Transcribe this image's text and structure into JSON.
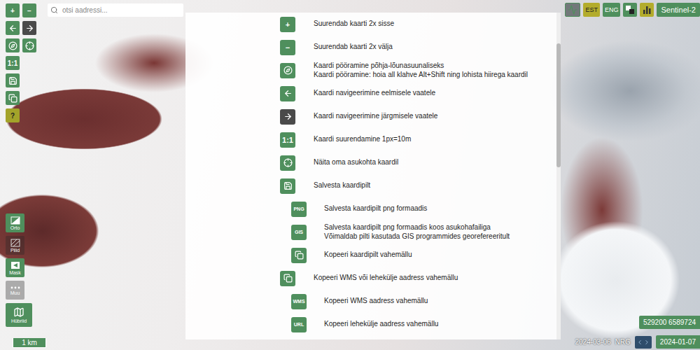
{
  "search": {
    "placeholder": "otsi aadressi..."
  },
  "toolbar": {
    "rows": [
      [
        {
          "kind": "text",
          "label": "+",
          "color": "#4f8f5d",
          "disabled": false
        },
        {
          "kind": "text",
          "label": "−",
          "color": "#4f8f5d",
          "disabled": false
        }
      ],
      [
        {
          "kind": "arrow-left",
          "color": "#4f8f5d",
          "disabled": false
        },
        {
          "kind": "arrow-right",
          "color": "#4a4a4a",
          "disabled": true
        }
      ],
      [
        {
          "kind": "compass",
          "color": "#4f8f5d",
          "disabled": false
        },
        {
          "kind": "target",
          "color": "#4f8f5d",
          "disabled": false
        }
      ],
      [
        {
          "kind": "text",
          "label": "1:1",
          "color": "#4f8f5d",
          "disabled": false
        }
      ],
      [
        {
          "kind": "save",
          "color": "#4f8f5d",
          "disabled": false
        }
      ],
      [
        {
          "kind": "copy",
          "color": "#4f8f5d",
          "disabled": false
        }
      ],
      [
        {
          "kind": "text",
          "label": "?",
          "color": "#a3a32a",
          "disabled": false
        }
      ]
    ]
  },
  "top_right": [
    {
      "kind": "chart"
    },
    {
      "kind": "lang",
      "label": "EST",
      "selected": true
    },
    {
      "kind": "lang",
      "label": "ENG",
      "selected": false
    },
    {
      "kind": "layers"
    },
    {
      "kind": "stats"
    },
    {
      "kind": "source",
      "label": "Sentinel-2"
    }
  ],
  "layers": [
    {
      "kind": "orto",
      "label": "Orto",
      "active": true
    },
    {
      "kind": "pilid",
      "label": "Pilid",
      "active": false
    },
    {
      "kind": "mask",
      "label": "Mask",
      "active": true
    },
    {
      "kind": "muu",
      "label": "Muu",
      "active": false
    },
    {
      "kind": "hybrid",
      "label": "Hübriid",
      "active": true
    }
  ],
  "scale": "1 km",
  "status": {
    "date_left": "2024-03-06",
    "band": "NRG",
    "date_right": "2024-01-07",
    "coordinates": "529200 6589724"
  },
  "help": {
    "scrollbar": {
      "level": 0.38
    },
    "items": [
      {
        "kind": "text",
        "icon_label": "+",
        "lines": [
          "Suurendab kaarti 2x sisse"
        ],
        "sub": false,
        "disabled": false
      },
      {
        "kind": "text",
        "icon_label": "−",
        "lines": [
          "Suurendab kaarti 2x välja"
        ],
        "sub": false,
        "disabled": false
      },
      {
        "kind": "compass",
        "lines": [
          "Kaardi pööramine põhja-lõunasuunaliseks",
          "Kaardi pööramine: hoia all klahve Alt+Shift ning lohista hiirega kaardil"
        ],
        "sub": false,
        "disabled": false
      },
      {
        "kind": "arrow-left",
        "lines": [
          "Kaardi navigeerimine eelmisele vaatele"
        ],
        "sub": false,
        "disabled": false
      },
      {
        "kind": "arrow-right",
        "lines": [
          "Kaardi navigeerimine järgmisele vaatele"
        ],
        "sub": false,
        "disabled": true
      },
      {
        "kind": "text",
        "icon_label": "1:1",
        "lines": [
          "Kaardi suurendamine 1px=10m"
        ],
        "sub": false,
        "disabled": false
      },
      {
        "kind": "target",
        "lines": [
          "Näita oma asukohta kaardil"
        ],
        "sub": false,
        "disabled": false
      },
      {
        "kind": "save",
        "lines": [
          "Salvesta kaardipilt"
        ],
        "sub": false,
        "disabled": false
      },
      {
        "kind": "text",
        "icon_label": "PNG",
        "lines": [
          "Salvesta kaardipilt png formaadis"
        ],
        "sub": true,
        "disabled": false
      },
      {
        "kind": "text",
        "icon_label": "GIS",
        "lines": [
          "Salvesta kaardipilt png formaadis koos asukohafailiga",
          "Võimaldab pilti kasutada GIS programmides georefereeritult"
        ],
        "sub": true,
        "disabled": false
      },
      {
        "kind": "copy",
        "lines": [
          "Kopeeri kaardipilt vahemällu"
        ],
        "sub": true,
        "disabled": false
      },
      {
        "kind": "copy",
        "lines": [
          "Kopeeri WMS või lehekülje aadress vahemällu"
        ],
        "sub": false,
        "disabled": false
      },
      {
        "kind": "text",
        "icon_label": "WMS",
        "lines": [
          "Kopeeri WMS aadress vahemällu"
        ],
        "sub": true,
        "disabled": false
      },
      {
        "kind": "text",
        "icon_label": "URL",
        "lines": [
          "Kopeeri lehekülje aadress vahemällu"
        ],
        "sub": true,
        "disabled": false
      }
    ]
  }
}
